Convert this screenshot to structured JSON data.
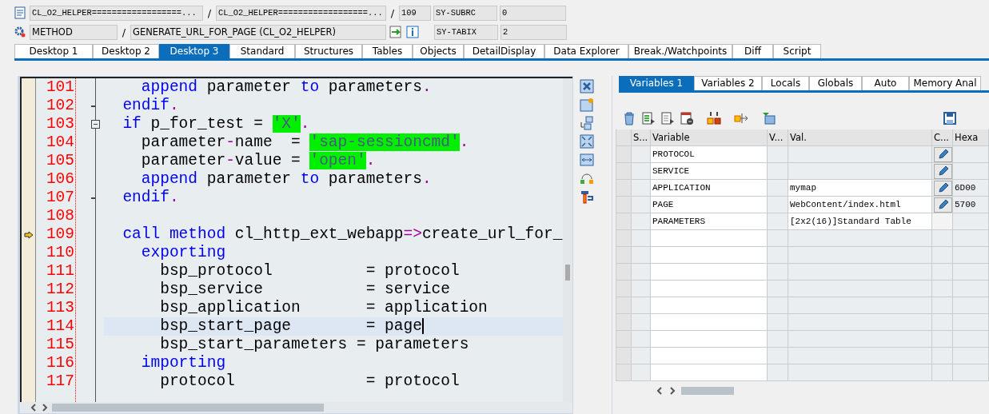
{
  "header": {
    "row1": {
      "program": "CL_O2_HELPER==================...",
      "include": "CL_O2_HELPER==================...",
      "line": "109",
      "sys_field": "SY-SUBRC",
      "sys_value": "0"
    },
    "row2": {
      "event_type": "METHOD",
      "event": "GENERATE_URL_FOR_PAGE (CL_O2_HELPER)",
      "sys_field": "SY-TABIX",
      "sys_value": "2"
    },
    "separators": [
      "/",
      "/",
      "/"
    ]
  },
  "desktop_tabs": [
    {
      "label": "Desktop 1",
      "selected": false
    },
    {
      "label": "Desktop 2",
      "selected": false
    },
    {
      "label": "Desktop 3",
      "selected": true
    },
    {
      "label": "Standard",
      "selected": false
    },
    {
      "label": "Structures",
      "selected": false
    },
    {
      "label": "Tables",
      "selected": false
    },
    {
      "label": "Objects",
      "selected": false
    },
    {
      "label": "DetailDisplay",
      "selected": false
    },
    {
      "label": "Data Explorer",
      "selected": false
    },
    {
      "label": "Break./Watchpoints",
      "selected": false
    },
    {
      "label": "Diff",
      "selected": false
    },
    {
      "label": "Script",
      "selected": false
    }
  ],
  "editor": {
    "lines": [
      {
        "number": "101",
        "fold_button": false,
        "fold_end": false,
        "debug_position": false,
        "current": false,
        "tokens": [
          {
            "kind": "keyword",
            "t": "    append"
          },
          {
            "kind": "plain",
            "t": " parameter "
          },
          {
            "kind": "keyword",
            "t": "to"
          },
          {
            "kind": "plain",
            "t": " parameters"
          },
          {
            "kind": "operator",
            "t": "."
          }
        ]
      },
      {
        "number": "102",
        "fold_button": false,
        "fold_end": true,
        "debug_position": false,
        "current": false,
        "tokens": [
          {
            "kind": "keyword",
            "t": "  endif"
          },
          {
            "kind": "operator",
            "t": "."
          }
        ]
      },
      {
        "number": "103",
        "fold_button": true,
        "fold_end": false,
        "debug_position": false,
        "current": false,
        "tokens": [
          {
            "kind": "keyword",
            "t": "  if"
          },
          {
            "kind": "plain",
            "t": " p_for_test = "
          },
          {
            "kind": "string",
            "t": "'X'"
          },
          {
            "kind": "operator",
            "t": "."
          }
        ]
      },
      {
        "number": "104",
        "fold_button": false,
        "fold_end": false,
        "debug_position": false,
        "current": false,
        "tokens": [
          {
            "kind": "plain",
            "t": "    parameter"
          },
          {
            "kind": "operator",
            "t": "-"
          },
          {
            "kind": "plain",
            "t": "name  = "
          },
          {
            "kind": "string",
            "t": "'sap-sessioncmd'"
          },
          {
            "kind": "operator",
            "t": "."
          }
        ]
      },
      {
        "number": "105",
        "fold_button": false,
        "fold_end": false,
        "debug_position": false,
        "current": false,
        "tokens": [
          {
            "kind": "plain",
            "t": "    parameter"
          },
          {
            "kind": "operator",
            "t": "-"
          },
          {
            "kind": "plain",
            "t": "value = "
          },
          {
            "kind": "string",
            "t": "'open'"
          },
          {
            "kind": "operator",
            "t": "."
          }
        ]
      },
      {
        "number": "106",
        "fold_button": false,
        "fold_end": false,
        "debug_position": false,
        "current": false,
        "tokens": [
          {
            "kind": "keyword",
            "t": "    append"
          },
          {
            "kind": "plain",
            "t": " parameter "
          },
          {
            "kind": "keyword",
            "t": "to"
          },
          {
            "kind": "plain",
            "t": " parameters"
          },
          {
            "kind": "operator",
            "t": "."
          }
        ]
      },
      {
        "number": "107",
        "fold_button": false,
        "fold_end": true,
        "debug_position": false,
        "current": false,
        "tokens": [
          {
            "kind": "keyword",
            "t": "  endif"
          },
          {
            "kind": "operator",
            "t": "."
          }
        ]
      },
      {
        "number": "108",
        "fold_button": false,
        "fold_end": false,
        "debug_position": false,
        "current": false
      },
      {
        "number": "109",
        "fold_button": false,
        "fold_end": false,
        "debug_position": true,
        "current": false,
        "tokens": [
          {
            "kind": "keyword",
            "t": "  call method"
          },
          {
            "kind": "plain",
            "t": " cl_http_ext_webapp"
          },
          {
            "kind": "operator",
            "t": "=>"
          },
          {
            "kind": "plain",
            "t": "create_url_for_"
          }
        ]
      },
      {
        "number": "110",
        "fold_button": false,
        "fold_end": false,
        "debug_position": false,
        "current": false,
        "tokens": [
          {
            "kind": "keyword",
            "t": "    exporting"
          }
        ]
      },
      {
        "number": "111",
        "fold_button": false,
        "fold_end": false,
        "debug_position": false,
        "current": false,
        "tokens": [
          {
            "kind": "plain",
            "t": "      bsp_protocol          = protocol"
          }
        ]
      },
      {
        "number": "112",
        "fold_button": false,
        "fold_end": false,
        "debug_position": false,
        "current": false,
        "tokens": [
          {
            "kind": "plain",
            "t": "      bsp_service           = service"
          }
        ]
      },
      {
        "number": "113",
        "fold_button": false,
        "fold_end": false,
        "debug_position": false,
        "current": false,
        "tokens": [
          {
            "kind": "plain",
            "t": "      bsp_application       = application"
          }
        ]
      },
      {
        "number": "114",
        "fold_button": false,
        "fold_end": false,
        "debug_position": false,
        "current": true,
        "tokens": [
          {
            "kind": "plain",
            "t": "      bsp_start_page        = page"
          }
        ]
      },
      {
        "number": "115",
        "fold_button": false,
        "fold_end": false,
        "debug_position": false,
        "current": false,
        "tokens": [
          {
            "kind": "plain",
            "t": "      bsp_start_parameters = parameters"
          }
        ]
      },
      {
        "number": "116",
        "fold_button": false,
        "fold_end": false,
        "debug_position": false,
        "current": false,
        "tokens": [
          {
            "kind": "keyword",
            "t": "    importing"
          }
        ]
      },
      {
        "number": "117",
        "fold_button": false,
        "fold_end": false,
        "debug_position": false,
        "current": false,
        "tokens": [
          {
            "kind": "plain",
            "t": "      protocol              = protocol"
          }
        ]
      }
    ]
  },
  "variable_tabs": [
    {
      "label": "Variables 1",
      "selected": true
    },
    {
      "label": "Variables 2",
      "selected": false
    },
    {
      "label": "Locals",
      "selected": false
    },
    {
      "label": "Globals",
      "selected": false
    },
    {
      "label": "Auto",
      "selected": false
    },
    {
      "label": "Memory Anal",
      "selected": false
    }
  ],
  "variables_table": {
    "columns": [
      "S...",
      "Variable",
      "V...",
      "Val.",
      "C...",
      "Hexa"
    ],
    "rows": [
      {
        "variable": "PROTOCOL",
        "editable": true
      },
      {
        "variable": "SERVICE",
        "editable": true
      },
      {
        "variable": "APPLICATION",
        "value": "mymap",
        "editable": true,
        "hex": "6D00"
      },
      {
        "variable": "PAGE",
        "value": "WebContent/index.html",
        "editable": true,
        "hex": "5700"
      },
      {
        "variable": "PARAMETERS",
        "value": "[2x2(16)]Standard Table",
        "editable": false
      }
    ]
  }
}
